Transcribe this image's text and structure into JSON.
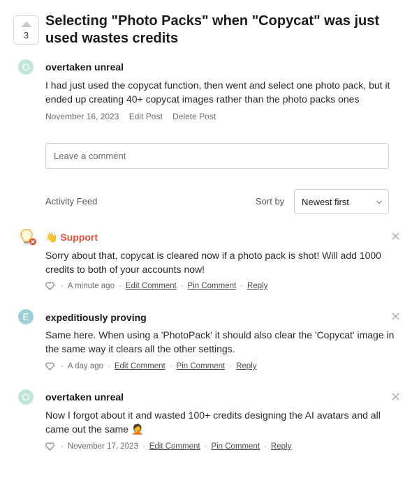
{
  "post": {
    "votes": "3",
    "title": "Selecting \"Photo Packs\" when \"Copycat\" was just used wastes credits",
    "author_initial": "O",
    "author": "overtaken unreal",
    "body": "I had just used the copycat function, then went and select one photo pack, but it ended up creating 40+ copycat images rather than the photo packs ones",
    "date": "November 16, 2023",
    "edit_label": "Edit Post",
    "delete_label": "Delete Post"
  },
  "comment_box": {
    "placeholder": "Leave a comment"
  },
  "feed": {
    "title": "Activity Feed",
    "sort_label": "Sort by",
    "sort_value": "Newest first"
  },
  "comments": [
    {
      "author": "👋 Support",
      "body": "Sorry about that, copycat is cleared now if a photo pack is shot! Will add 1000 credits to both of your accounts now!",
      "time": "A minute ago",
      "edit": "Edit Comment",
      "pin": "Pin Comment",
      "reply": "Reply",
      "name_color": "#e0533d"
    },
    {
      "initial": "E",
      "author": "expeditiously proving",
      "body": "Same here. When using a 'PhotoPack' it should also clear the 'Copycat' image in the same way it clears all the other settings.",
      "time": "A day ago",
      "edit": "Edit Comment",
      "pin": "Pin Comment",
      "reply": "Reply"
    },
    {
      "initial": "O",
      "author": "overtaken unreal",
      "body": "Now I forgot about it and wasted 100+ credits designing the AI avatars and all came out the same 🤦",
      "time": "November 17, 2023",
      "edit": "Edit Comment",
      "pin": "Pin Comment",
      "reply": "Reply"
    }
  ],
  "icons": {
    "vote": "upvote-arrow-icon",
    "close": "close-icon",
    "heart": "heart-icon",
    "sort": "chevron-down-icon",
    "support_avatar": "lightbulb-icon"
  },
  "colors": {
    "support_name": "#e0533d",
    "avatar_o": "#bfe6d6",
    "avatar_e": "#9fcfd6"
  }
}
